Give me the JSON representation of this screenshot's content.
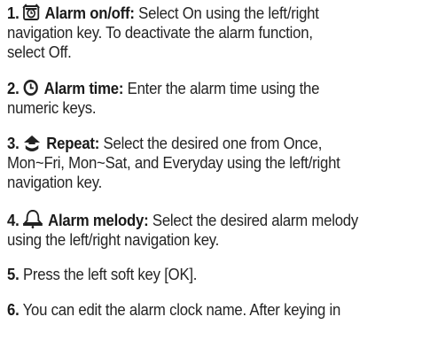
{
  "steps": [
    {
      "number": "1.",
      "icon": "alarm-clock-icon",
      "title": "Alarm on/off:",
      "lines": [
        "Select On using the left/right",
        "navigation key. To deactivate the alarm function,",
        "select Off."
      ]
    },
    {
      "number": "2.",
      "icon": "clock-icon",
      "title": "Alarm time:",
      "lines": [
        "Enter the alarm time using the",
        "numeric keys."
      ]
    },
    {
      "number": "3.",
      "icon": "repeat-arrow-icon",
      "title": "Repeat:",
      "lines": [
        "Select the desired one from Once,",
        "Mon~Fri, Mon~Sat, and Everyday using the left/right",
        "navigation key."
      ]
    },
    {
      "number": "4.",
      "icon": "bell-icon",
      "title": "Alarm melody:",
      "lines": [
        "Select the desired alarm melody",
        "using the left/right navigation key."
      ]
    },
    {
      "number": "5.",
      "lines": [
        "Press the left soft key [OK]."
      ]
    },
    {
      "number": "6.",
      "lines": [
        "You can edit the alarm clock name. After keying in"
      ]
    }
  ]
}
